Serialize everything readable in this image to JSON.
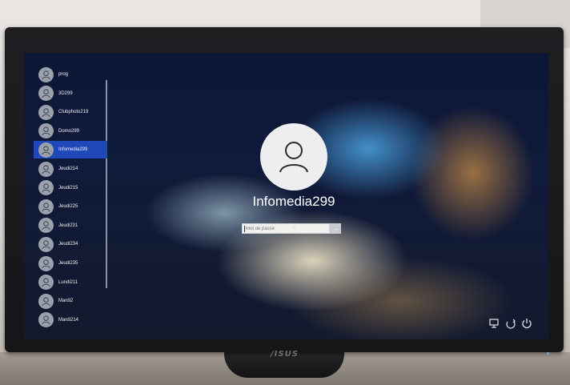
{
  "users": [
    {
      "name": "prog",
      "selected": false
    },
    {
      "name": "3D299",
      "selected": false
    },
    {
      "name": "Clubphoto219",
      "selected": false
    },
    {
      "name": "Domo299",
      "selected": false
    },
    {
      "name": "Infomedia299",
      "selected": true
    },
    {
      "name": "Jeudi214",
      "selected": false
    },
    {
      "name": "Jeudi215",
      "selected": false
    },
    {
      "name": "Jeudi225",
      "selected": false
    },
    {
      "name": "Jeudi231",
      "selected": false
    },
    {
      "name": "Jeudi234",
      "selected": false
    },
    {
      "name": "Jeudi235",
      "selected": false
    },
    {
      "name": "Lundi211",
      "selected": false
    },
    {
      "name": "Mardi2",
      "selected": false
    },
    {
      "name": "Mardi214",
      "selected": false
    }
  ],
  "login": {
    "username": "Infomedia299",
    "password_placeholder": "Mot de passe",
    "submit_icon": "arrow-right-icon"
  },
  "bottom_icons": [
    "network-icon",
    "accessibility-icon",
    "power-icon"
  ],
  "monitor": {
    "brand": "/ISUS"
  },
  "colors": {
    "selected": "#1f48b8",
    "background": "#0c1636"
  }
}
